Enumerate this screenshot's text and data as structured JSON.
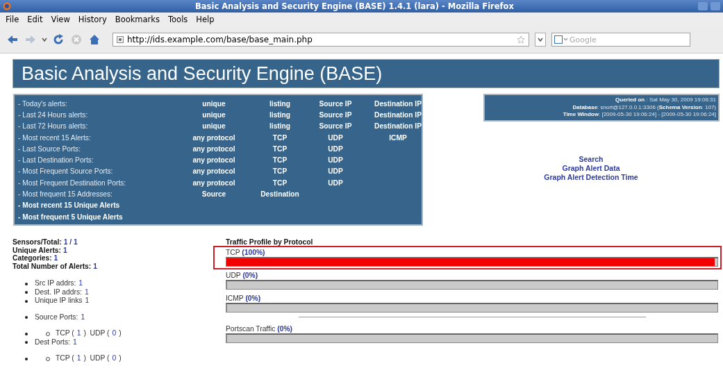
{
  "window": {
    "title": "Basic Analysis and Security Engine (BASE) 1.4.1 (lara) - Mozilla Firefox"
  },
  "menu": [
    "File",
    "Edit",
    "View",
    "History",
    "Bookmarks",
    "Tools",
    "Help"
  ],
  "toolbar": {
    "url": "http://ids.example.com/base/base_main.php",
    "search_placeholder": "Google"
  },
  "page": {
    "title": "Basic Analysis and Security Engine (BASE)",
    "nav_rows": [
      {
        "kind": "text",
        "label": "- Today's alerts:",
        "links": [
          "unique",
          "listing",
          "Source IP",
          "Destination IP"
        ]
      },
      {
        "kind": "text",
        "label": "- Last 24 Hours alerts:",
        "links": [
          "unique",
          "listing",
          "Source IP",
          "Destination IP"
        ]
      },
      {
        "kind": "text",
        "label": "- Last 72 Hours alerts:",
        "links": [
          "unique",
          "listing",
          "Source IP",
          "Destination IP"
        ]
      },
      {
        "kind": "text",
        "label": "- Most recent 15 Alerts:",
        "links": [
          "any protocol",
          "TCP",
          "UDP",
          "ICMP"
        ]
      },
      {
        "kind": "text",
        "label": "- Last Source Ports:",
        "links": [
          "any protocol",
          "TCP",
          "UDP"
        ]
      },
      {
        "kind": "text",
        "label": "- Last Destination Ports:",
        "links": [
          "any protocol",
          "TCP",
          "UDP"
        ]
      },
      {
        "kind": "text",
        "label": "- Most Frequent Source Ports:",
        "links": [
          "any protocol",
          "TCP",
          "UDP"
        ]
      },
      {
        "kind": "text",
        "label": "- Most Frequent Destination Ports:",
        "links": [
          "any protocol",
          "TCP",
          "UDP"
        ]
      },
      {
        "kind": "text",
        "label": "- Most frequent 15 Addresses:",
        "links": [
          "Source",
          "Destination"
        ]
      },
      {
        "kind": "link",
        "label": "- Most recent 15 Unique Alerts",
        "links": []
      },
      {
        "kind": "link",
        "label": "- Most frequent 5 Unique Alerts",
        "links": []
      }
    ],
    "info_lines": [
      "**Queried on** : Sat May 30, 2009 19:06:31",
      "**Database**: snort@127.0.0.1:3306   (**Schema Version**: 107)",
      "**Time Window**: [2009-05-30 19:06:24] - [2009-05-30 19:06:24]"
    ],
    "side_links": [
      "Search",
      "Graph Alert Data",
      "Graph Alert Detection Time"
    ],
    "stats": [
      {
        "label": "Sensors/Total:",
        "value": "1 / 1"
      },
      {
        "label": "Unique Alerts:",
        "value": "1"
      },
      {
        "label": "Categories:",
        "value": "1"
      },
      {
        "label": "Total Number of Alerts:",
        "value": "1"
      }
    ],
    "detail_groups": [
      [
        {
          "kind": "count",
          "label": "Src IP addrs:",
          "value": "1"
        },
        {
          "kind": "count",
          "label": "Dest. IP addrs:",
          "value": "1"
        },
        {
          "kind": "count",
          "label": "Unique IP links",
          "value": "1"
        }
      ],
      [
        {
          "kind": "count",
          "label": "Source Ports:",
          "value": "1"
        }
      ],
      [
        {
          "kind": "protocols",
          "parts": [
            {
              "kind": "text",
              "text": "TCP ("
            },
            {
              "kind": "value",
              "text": "1"
            },
            {
              "kind": "text",
              "text": ")  UDP ("
            },
            {
              "kind": "value",
              "text": "0"
            },
            {
              "kind": "text",
              "text": ")"
            }
          ]
        },
        {
          "kind": "count",
          "label": "Dest Ports:",
          "value": "1"
        }
      ],
      [
        {
          "kind": "protocols",
          "parts": [
            {
              "kind": "text",
              "text": "TCP ("
            },
            {
              "kind": "value",
              "text": "1"
            },
            {
              "kind": "text",
              "text": ")  UDP ("
            },
            {
              "kind": "value",
              "text": "0"
            },
            {
              "kind": "text",
              "text": ")"
            }
          ]
        }
      ]
    ],
    "traffic": {
      "title": "Traffic Profile by Protocol",
      "sections": [
        [
          {
            "label": "TCP",
            "percent": "(100%)",
            "level": 1,
            "highlighted": true
          },
          {
            "label": "UDP",
            "percent": "(0%)",
            "level": 0,
            "highlighted": false
          },
          {
            "label": "ICMP",
            "percent": "(0%)",
            "level": 0,
            "highlighted": false
          }
        ],
        [
          {
            "label": "Portscan Traffic",
            "percent": "(0%)",
            "level": 0,
            "highlighted": false
          }
        ]
      ]
    }
  }
}
